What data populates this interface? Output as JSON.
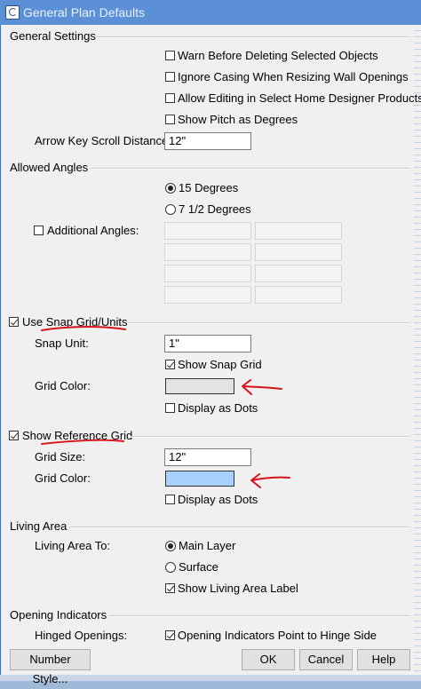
{
  "window": {
    "title": "General Plan Defaults"
  },
  "general_settings": {
    "title": "General Settings",
    "warn_delete": {
      "label": "Warn Before Deleting Selected Objects",
      "checked": false
    },
    "ignore_casing": {
      "label": "Ignore Casing When Resizing Wall Openings",
      "checked": false
    },
    "allow_editing": {
      "label": "Allow Editing in Select Home Designer Products",
      "checked": false
    },
    "show_pitch": {
      "label": "Show Pitch as Degrees",
      "checked": false
    },
    "arrow_key_label": "Arrow Key Scroll Distance:",
    "arrow_key_value": "12\""
  },
  "allowed_angles": {
    "title": "Allowed Angles",
    "option_15": {
      "label": "15 Degrees",
      "selected": true
    },
    "option_7": {
      "label": "7 1/2 Degrees",
      "selected": false
    },
    "additional_label": "Additional Angles:",
    "additional_checked": false
  },
  "snap_grid": {
    "title": "Use Snap Grid/Units",
    "checked": true,
    "snap_unit_label": "Snap Unit:",
    "snap_unit_value": "1\"",
    "show_snap_grid": {
      "label": "Show Snap Grid",
      "checked": true
    },
    "grid_color_label": "Grid Color:",
    "grid_color": "#e3e3e3",
    "display_dots": {
      "label": "Display as Dots",
      "checked": false
    }
  },
  "reference_grid": {
    "title": "Show Reference Grid",
    "checked": true,
    "grid_size_label": "Grid Size:",
    "grid_size_value": "12\"",
    "grid_color_label": "Grid Color:",
    "grid_color": "#a9d1ff",
    "display_dots": {
      "label": "Display as Dots",
      "checked": false
    }
  },
  "living_area": {
    "title": "Living Area",
    "to_label": "Living Area To:",
    "main_layer": {
      "label": "Main Layer",
      "selected": true
    },
    "surface": {
      "label": "Surface",
      "selected": false
    },
    "show_label": {
      "label": "Show Living Area Label",
      "checked": true
    }
  },
  "opening_indicators": {
    "title": "Opening Indicators",
    "hinged_label": "Hinged Openings:",
    "point_to_hinge": {
      "label": "Opening Indicators Point to Hinge Side",
      "checked": true
    }
  },
  "buttons": {
    "number_style": "Number Style...",
    "ok": "OK",
    "cancel": "Cancel",
    "help": "Help"
  },
  "annotation_color": "#d8141a"
}
